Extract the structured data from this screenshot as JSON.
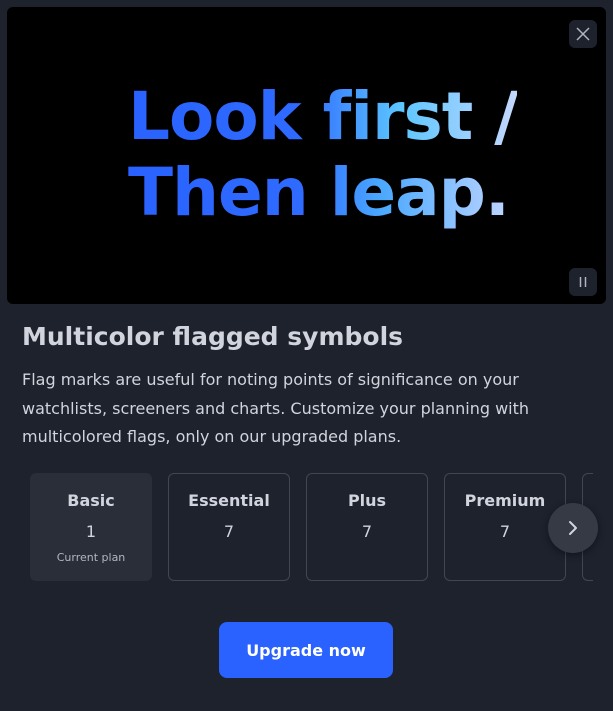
{
  "banner": {
    "line1": "Look first /",
    "line2": "Then leap.",
    "close_icon": "close-icon",
    "pause_icon": "pause-icon"
  },
  "title": "Multicolor flagged symbols",
  "description": "Flag marks are useful for noting points of significance on your watchlists, screeners and charts. Customize your planning with multicolored flags, only on our upgraded plans.",
  "plans": [
    {
      "name": "Basic",
      "value": "1",
      "note": "Current plan"
    },
    {
      "name": "Essential",
      "value": "7"
    },
    {
      "name": "Plus",
      "value": "7"
    },
    {
      "name": "Premium",
      "value": "7"
    }
  ],
  "next_icon": "chevron-right-icon",
  "cta": {
    "label": "Upgrade now"
  },
  "colors": {
    "background": "#1e222d",
    "accent": "#2962ff",
    "card_border": "#434651",
    "current_card": "#2a2e39"
  }
}
